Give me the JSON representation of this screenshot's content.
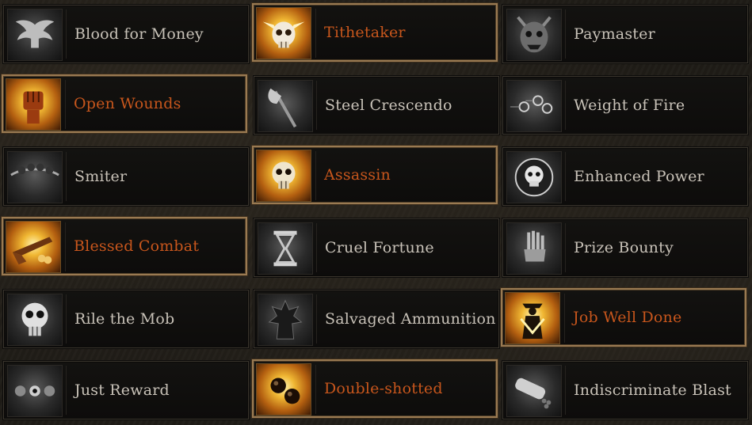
{
  "talents": [
    {
      "label": "Blood for Money",
      "active": false,
      "icon": "dove-icon"
    },
    {
      "label": "Tithetaker",
      "active": true,
      "icon": "winged-skull-icon"
    },
    {
      "label": "Paymaster",
      "active": false,
      "icon": "demon-face-icon"
    },
    {
      "label": "Open Wounds",
      "active": true,
      "icon": "fist-icon"
    },
    {
      "label": "Steel Crescendo",
      "active": false,
      "icon": "axe-icon"
    },
    {
      "label": "Weight of Fire",
      "active": false,
      "icon": "bullets-icon"
    },
    {
      "label": "Smiter",
      "active": false,
      "icon": "crowd-icon"
    },
    {
      "label": "Assassin",
      "active": true,
      "icon": "glowing-skull-icon"
    },
    {
      "label": "Enhanced Power",
      "active": false,
      "icon": "skull-circle-icon"
    },
    {
      "label": "Blessed Combat",
      "active": true,
      "icon": "pistol-icon"
    },
    {
      "label": "Cruel Fortune",
      "active": false,
      "icon": "hourglass-icon"
    },
    {
      "label": "Prize Bounty",
      "active": false,
      "icon": "hand-icon"
    },
    {
      "label": "Rile the Mob",
      "active": false,
      "icon": "skull-icon"
    },
    {
      "label": "Salvaged Ammunition",
      "active": false,
      "icon": "spiked-figure-icon"
    },
    {
      "label": "Job Well Done",
      "active": true,
      "icon": "hunter-figure-icon"
    },
    {
      "label": "Just Reward",
      "active": false,
      "icon": "masks-icon"
    },
    {
      "label": "Double-shotted",
      "active": true,
      "icon": "cannonballs-icon"
    },
    {
      "label": "Indiscriminate Blast",
      "active": false,
      "icon": "shell-icon"
    }
  ],
  "colors": {
    "active_text": "#c7561c",
    "inactive_text": "#c8c2b8",
    "active_border": "#9a7a52"
  }
}
